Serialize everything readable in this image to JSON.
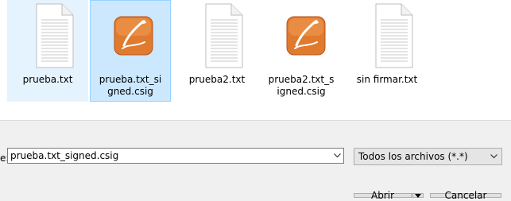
{
  "files": [
    {
      "name": "prueba.txt",
      "type": "text-document-icon",
      "state": "hover"
    },
    {
      "name": "prueba.txt_signed.csig",
      "type": "signature-file-icon",
      "state": "selected"
    },
    {
      "name": "prueba2.txt",
      "type": "text-document-icon",
      "state": "normal"
    },
    {
      "name": "prueba2.txt_signed.csig",
      "type": "signature-file-icon",
      "state": "normal"
    },
    {
      "name": "sin firmar.txt",
      "type": "text-document-icon",
      "state": "normal"
    }
  ],
  "filename_label": "e:",
  "filename_value": "prueba.txt_signed.csig",
  "filetype_value": "Todos los archivos (*.*)",
  "open_label": "Abrir",
  "cancel_label": "Cancelar",
  "colors": {
    "selected_bg": "#cce8ff",
    "selected_border": "#99d1ff",
    "hover_bg": "#e5f3ff",
    "signature_orange": "#e07a2e"
  }
}
